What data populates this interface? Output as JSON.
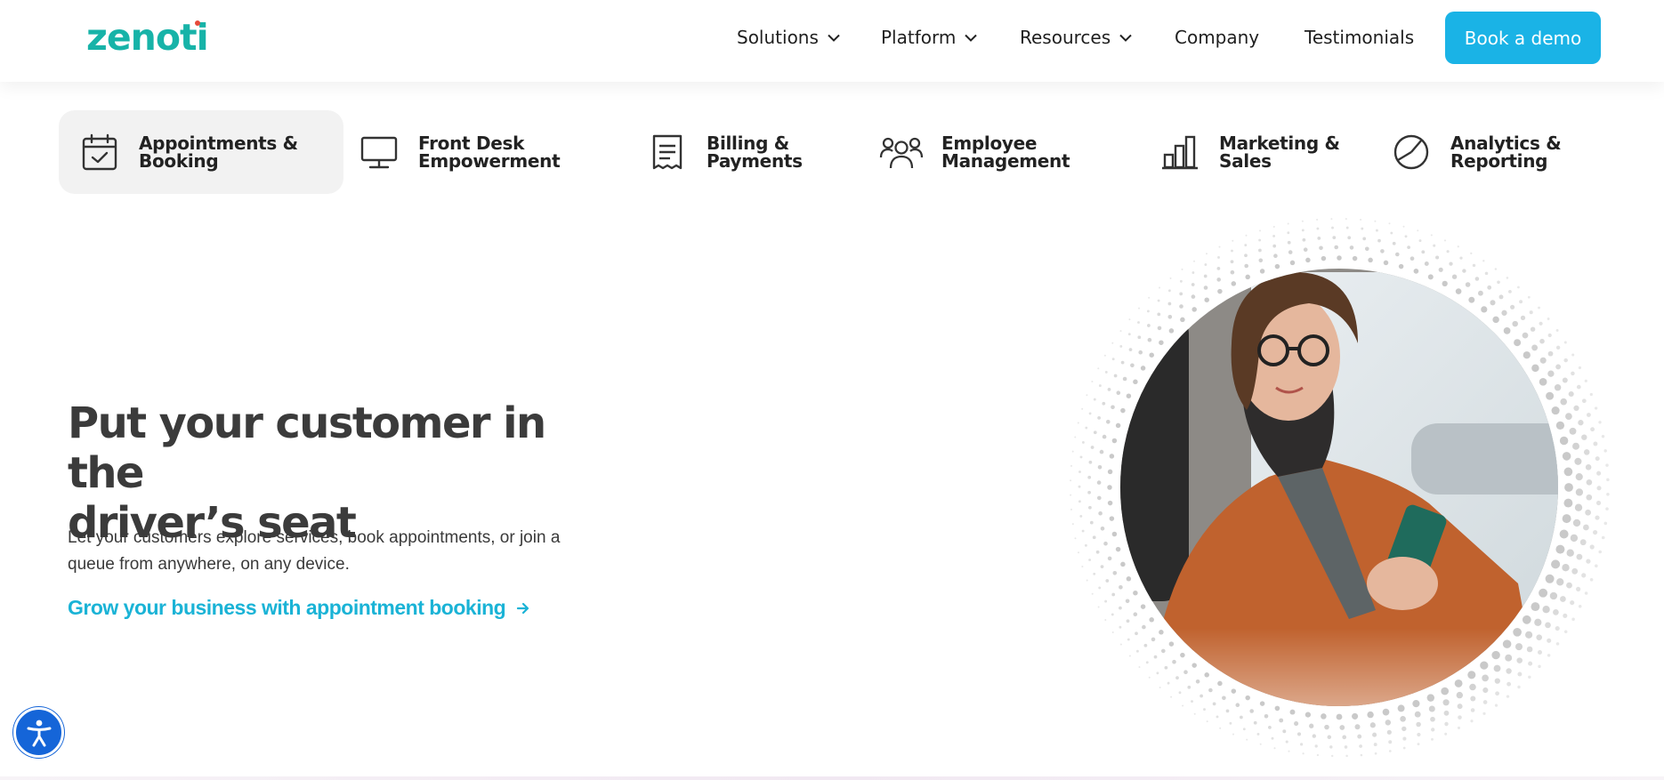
{
  "brand": {
    "name": "zenoti",
    "accent": "#17b3a8",
    "cta_color": "#1ab3e6"
  },
  "nav": {
    "items": [
      {
        "label": "Solutions",
        "has_dropdown": true
      },
      {
        "label": "Platform",
        "has_dropdown": true
      },
      {
        "label": "Resources",
        "has_dropdown": true
      },
      {
        "label": "Company",
        "has_dropdown": false
      },
      {
        "label": "Testimonials",
        "has_dropdown": false
      }
    ],
    "cta": "Book a demo"
  },
  "tabs": [
    {
      "line1": "Appointments &",
      "line2": "Booking",
      "icon": "calendar-check-icon",
      "active": true
    },
    {
      "line1": "Front Desk",
      "line2": "Empowerment",
      "icon": "monitor-icon",
      "active": false
    },
    {
      "line1": "Billing &",
      "line2": "Payments",
      "icon": "receipt-icon",
      "active": false
    },
    {
      "line1": "Employee",
      "line2": "Management",
      "icon": "team-icon",
      "active": false
    },
    {
      "line1": "Marketing &",
      "line2": "Sales",
      "icon": "bar-chart-icon",
      "active": false
    },
    {
      "line1": "Analytics &",
      "line2": "Reporting",
      "icon": "pie-chart-icon",
      "active": false
    }
  ],
  "hero": {
    "title_line1": "Put your customer in the",
    "title_line2": "driver’s seat",
    "description": "Let your customers explore services, book appointments, or join a queue from anywhere, on any device.",
    "link": "Grow your business with appointment booking",
    "link_icon": "arrow-right-icon",
    "image": "woman-in-car-using-phone"
  },
  "accessibility": {
    "icon": "accessibility-icon"
  }
}
